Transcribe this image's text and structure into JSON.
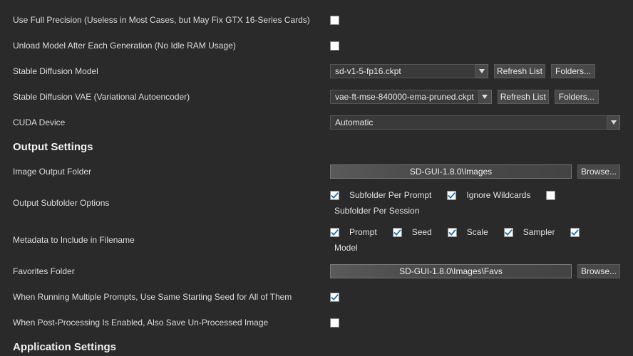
{
  "rows": {
    "full_precision": {
      "label": "Use Full Precision (Useless in Most Cases, but May Fix GTX 16-Series Cards)",
      "checked": false
    },
    "unload_model": {
      "label": "Unload Model After Each Generation (No Idle RAM Usage)",
      "checked": false
    },
    "sd_model": {
      "label": "Stable Diffusion Model",
      "value": "sd-v1-5-fp16.ckpt",
      "refresh": "Refresh List",
      "folders": "Folders..."
    },
    "sd_vae": {
      "label": "Stable Diffusion VAE (Variational Autoencoder)",
      "value": "vae-ft-mse-840000-ema-pruned.ckpt",
      "refresh": "Refresh List",
      "folders": "Folders..."
    },
    "cuda": {
      "label": "CUDA Device",
      "value": "Automatic"
    }
  },
  "output_heading": "Output Settings",
  "output": {
    "folder": {
      "label": "Image Output Folder",
      "value": "SD-GUI-1.8.0\\Images",
      "browse": "Browse..."
    },
    "subfolder": {
      "label": "Output Subfolder Options",
      "opts": [
        {
          "label": "Subfolder Per Prompt",
          "checked": true
        },
        {
          "label": "Ignore Wildcards",
          "checked": true
        },
        {
          "label": "Subfolder Per Session",
          "checked": false
        }
      ]
    },
    "metadata": {
      "label": "Metadata to Include in Filename",
      "opts": [
        {
          "label": "Prompt",
          "checked": true
        },
        {
          "label": "Seed",
          "checked": true
        },
        {
          "label": "Scale",
          "checked": true
        },
        {
          "label": "Sampler",
          "checked": true
        },
        {
          "label": "Model",
          "checked": true
        }
      ]
    },
    "favorites": {
      "label": "Favorites Folder",
      "value": "SD-GUI-1.8.0\\Images\\Favs",
      "browse": "Browse..."
    },
    "same_seed": {
      "label": "When Running Multiple Prompts, Use Same Starting Seed for All of Them",
      "checked": true
    },
    "save_unprocessed": {
      "label": "When Post-Processing Is Enabled, Also Save Un-Processed Image",
      "checked": false
    }
  },
  "app_heading": "Application Settings"
}
